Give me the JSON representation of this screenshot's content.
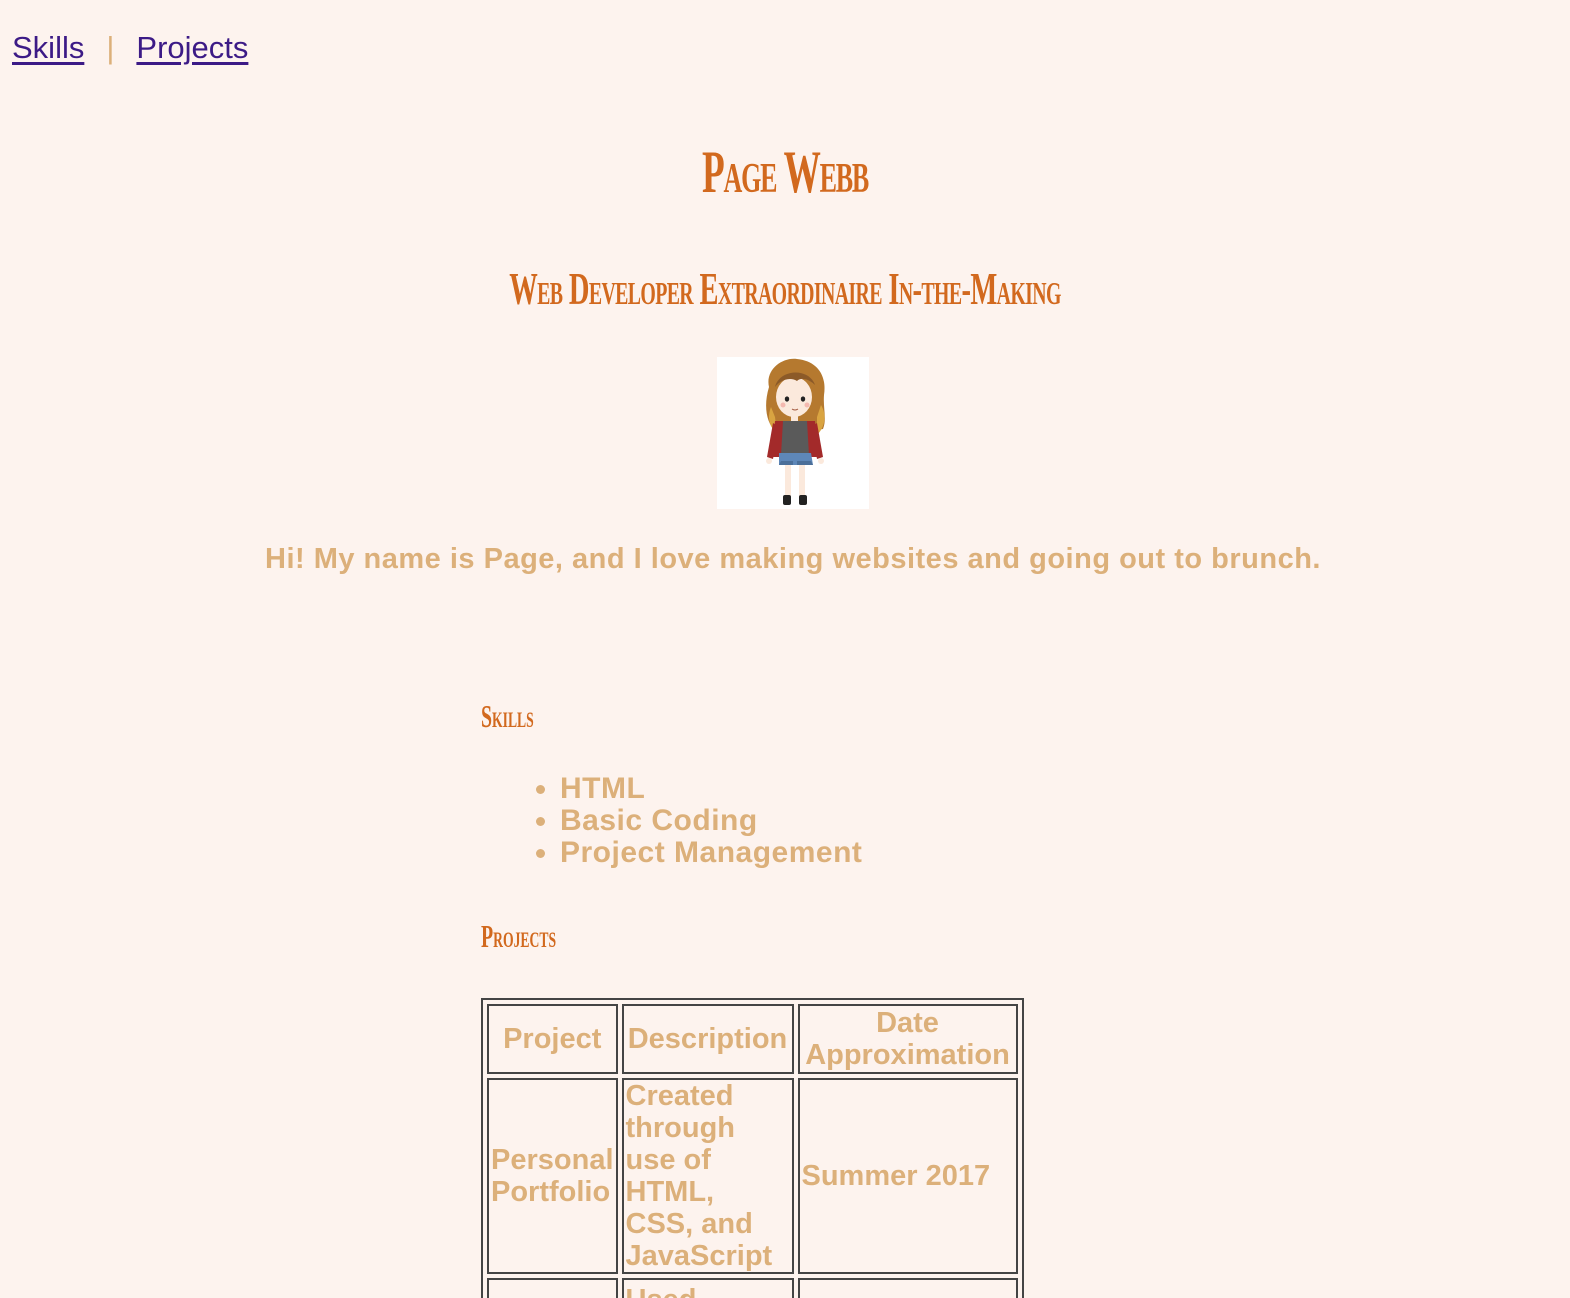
{
  "nav": {
    "skills_label": "Skills",
    "separator": "|",
    "projects_label": "Projects"
  },
  "header": {
    "name": "Page Webb",
    "tagline": "Web Developer Extraordinaire In-the-Making"
  },
  "intro": "Hi! My name is Page, and I love making websites and going out to brunch.",
  "skills": {
    "heading": "Skills",
    "items": [
      "HTML",
      "Basic Coding",
      "Project Management"
    ]
  },
  "projects": {
    "heading": "Projects",
    "columns": [
      "Project",
      "Description",
      "Date Approximation"
    ],
    "rows": [
      {
        "project": "Personal Portfolio",
        "description": "Created through use of HTML, CSS, and JavaScript",
        "date": "Summer 2017"
      }
    ],
    "partial_row_description": "Used"
  },
  "colors": {
    "background": "#fdf3ee",
    "heading": "#d2691e",
    "body_text": "#dcb07a",
    "link": "#3c1a86"
  }
}
